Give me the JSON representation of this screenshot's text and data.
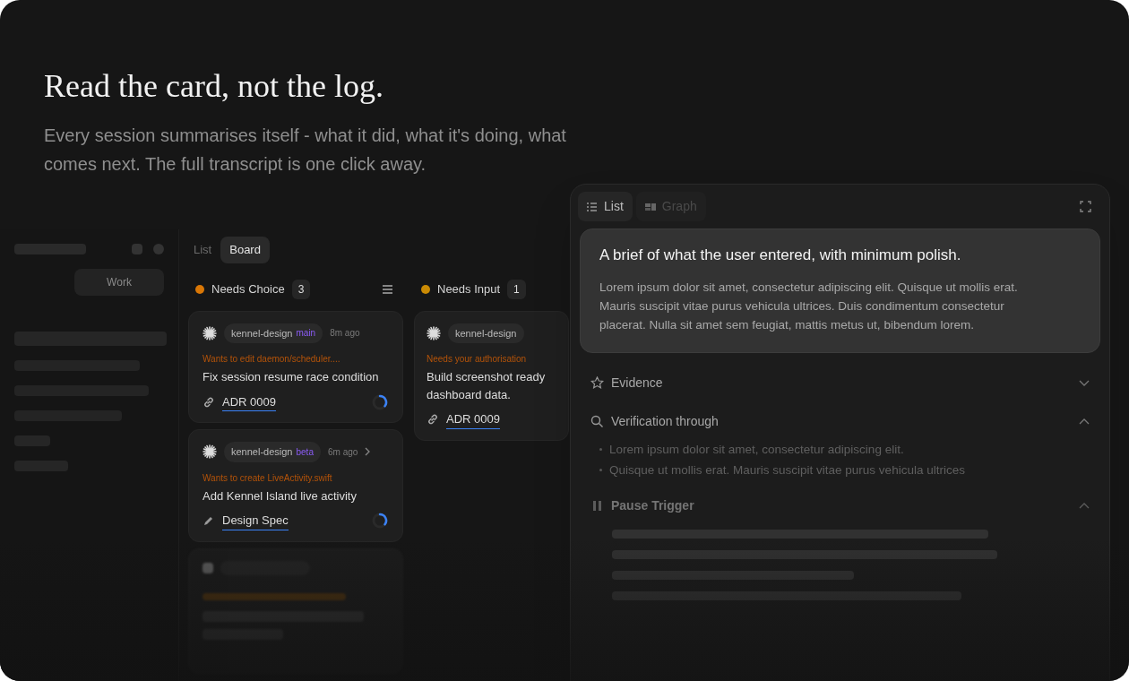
{
  "hero": {
    "title": "Read the card, not the log.",
    "subtitle": "Every session summarises itself - what it did, what it's doing, what comes next. The full transcript is one click away."
  },
  "sidebar": {
    "segment": "Work"
  },
  "board": {
    "tabs": [
      {
        "label": "List",
        "selected": false
      },
      {
        "label": "Board",
        "selected": true
      }
    ],
    "columns": [
      {
        "title": "Needs Choice",
        "count": "3",
        "color": "#d97706",
        "has_menu": true,
        "cards": [
          {
            "kind": "link",
            "repo": "kennel-design",
            "branch": "main",
            "time": "8m ago",
            "action": "Wants to edit daemon/scheduler....",
            "title": "Fix session resume race condition",
            "link": "ADR 0009",
            "has_chevron": false
          },
          {
            "kind": "edit",
            "repo": "kennel-design",
            "branch": "beta",
            "time": "6m ago",
            "action": "Wants to create LiveActivity.swift",
            "title": "Add Kennel Island live activity",
            "link": "Design Spec",
            "has_chevron": true
          },
          {
            "kind": "placeholder"
          }
        ]
      },
      {
        "title": "Needs Input",
        "count": "1",
        "color": "#ca8a04",
        "has_menu": false,
        "cards": [
          {
            "kind": "link",
            "repo": "kennel-design",
            "action": "Needs your authorisation",
            "title": "Build screenshot ready",
            "title_2": "dashboard data.",
            "link": "ADR 0009",
            "has_chevron": false
          }
        ]
      }
    ]
  },
  "detail": {
    "tabs": [
      {
        "label": "List",
        "selected": true
      },
      {
        "label": "Graph",
        "selected": false
      }
    ],
    "brief": {
      "title": "A brief of what the user entered, with minimum polish.",
      "body": "Lorem ipsum dolor sit amet, consectetur adipiscing elit. Quisque ut mollis erat. Mauris suscipit vitae purus vehicula ultrices. Duis condimentum consectetur placerat. Nulla sit amet sem feugiat, mattis metus ut, bibendum lorem."
    },
    "sections": [
      {
        "kind": "star",
        "title": "Evidence",
        "expanded": false,
        "dimmed": false
      },
      {
        "kind": "search",
        "title": "Verification through",
        "expanded": true,
        "dimmed": false,
        "bullets": [
          "Lorem ipsum dolor sit amet, consectetur adipiscing elit.",
          "Quisque ut mollis erat. Mauris suscipit vitae purus vehicula ultrices"
        ]
      },
      {
        "kind": "pause",
        "title": "Pause Trigger",
        "expanded": true,
        "dimmed": true
      }
    ]
  }
}
